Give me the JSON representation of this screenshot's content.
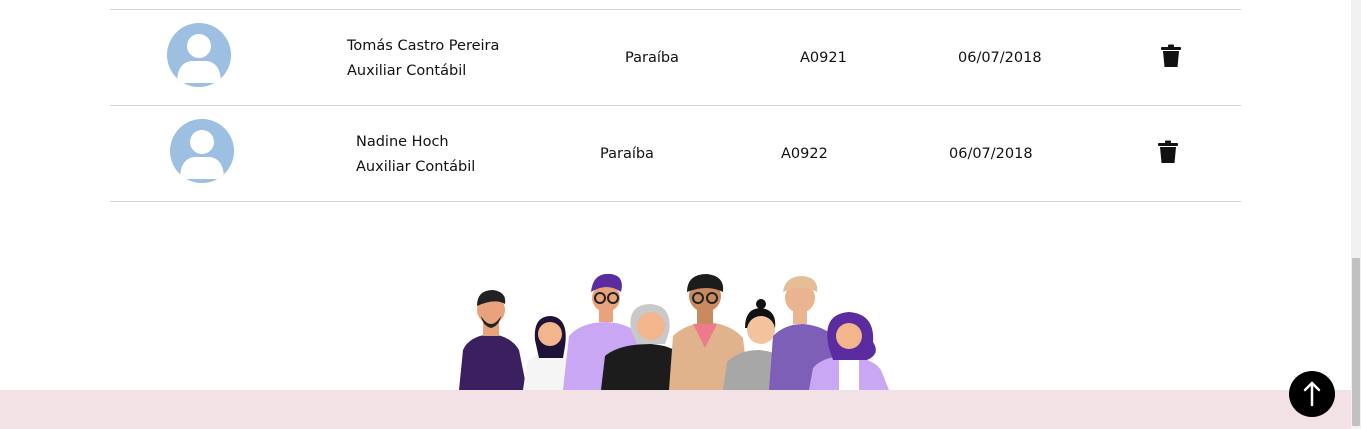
{
  "employees": [
    {
      "name": "Tomás Castro Pereira",
      "role": "Auxiliar Contábil",
      "state": "Paraíba",
      "code": "A0921",
      "date": "06/07/2018",
      "avatar_icon": "user-avatar-placeholder",
      "action_icon": "trash-icon"
    },
    {
      "name": "Nadine Hoch",
      "role": "Auxiliar Contábil",
      "state": "Paraíba",
      "code": "A0922",
      "date": "06/07/2018",
      "avatar_icon": "user-avatar-placeholder",
      "action_icon": "trash-icon"
    }
  ],
  "illustration": {
    "icon": "team-people-illustration"
  },
  "back_to_top": {
    "icon": "arrow-up-icon"
  },
  "colors": {
    "footer_bg": "#f2e2e6",
    "avatar_bg": "#9dbfe1",
    "divider": "#d4d4d4",
    "button_bg": "#000000"
  }
}
